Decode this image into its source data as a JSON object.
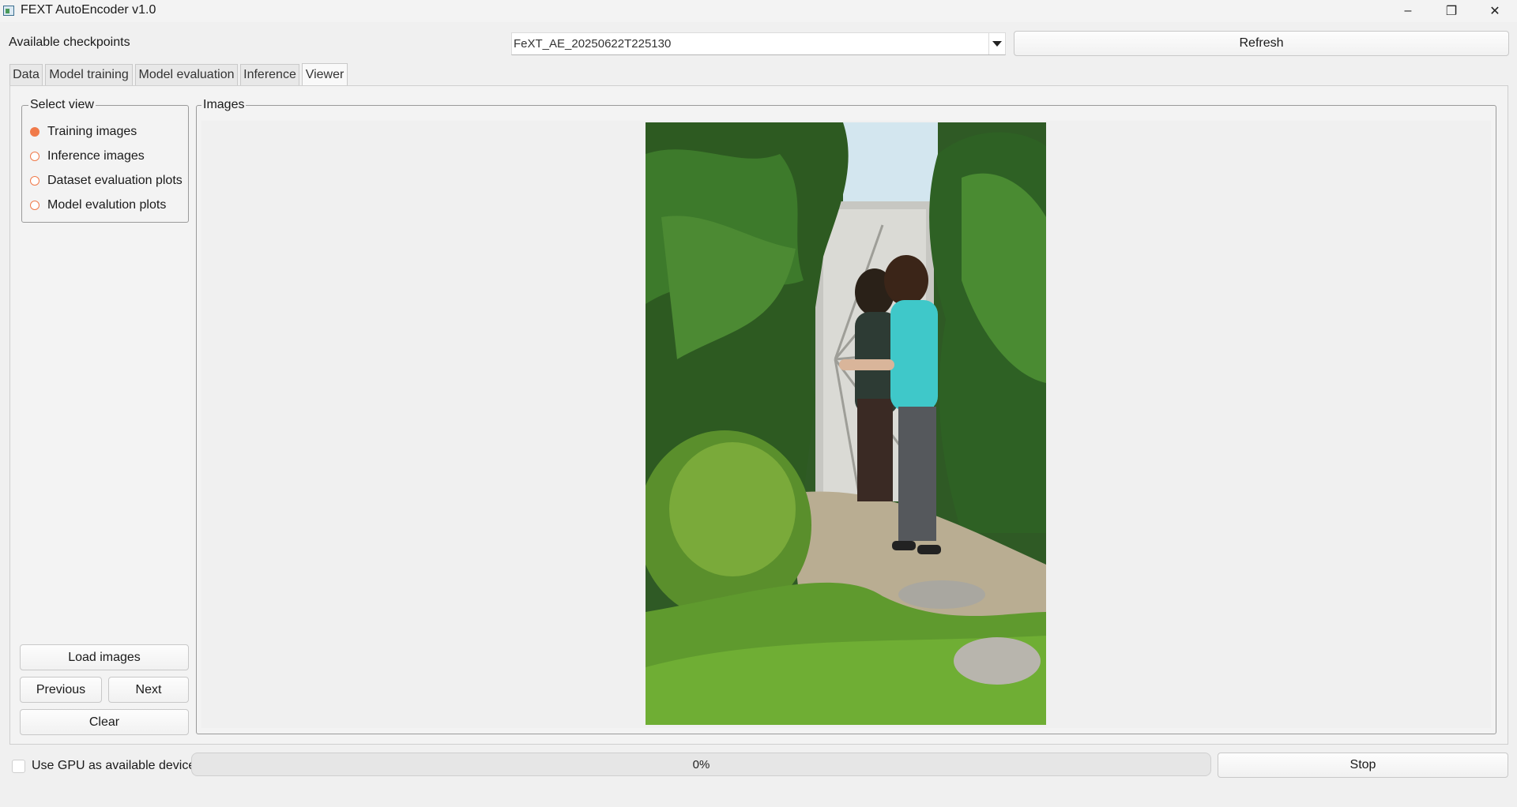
{
  "window": {
    "title": "FEXT AutoEncoder v1.0",
    "minimize_glyph": "–",
    "maximize_glyph": "❐",
    "close_glyph": "✕"
  },
  "checkpoints": {
    "label": "Available checkpoints",
    "selected": "FeXT_AE_20250622T225130",
    "refresh_label": "Refresh"
  },
  "tabs": [
    {
      "label": "Data",
      "active": false
    },
    {
      "label": "Model training",
      "active": false
    },
    {
      "label": "Model evaluation",
      "active": false
    },
    {
      "label": "Inference",
      "active": false
    },
    {
      "label": "Viewer",
      "active": true
    }
  ],
  "select_view": {
    "title": "Select view",
    "options": [
      {
        "label": "Training images",
        "checked": true
      },
      {
        "label": "Inference images",
        "checked": false
      },
      {
        "label": "Dataset evaluation plots",
        "checked": false
      },
      {
        "label": "Model evalution plots",
        "checked": false
      }
    ]
  },
  "buttons": {
    "load_images": "Load images",
    "previous": "Previous",
    "next": "Next",
    "clear": "Clear",
    "stop": "Stop"
  },
  "images_group": {
    "title": "Images",
    "image_semantic": "photo of two people in a garden with shrubs and stepping stones"
  },
  "footer": {
    "gpu_label": "Use GPU as available device",
    "gpu_checked": false,
    "progress_value": 0,
    "progress_text": "0%"
  },
  "colors": {
    "accent": "#f07a4a",
    "background": "#f0f0f0"
  }
}
